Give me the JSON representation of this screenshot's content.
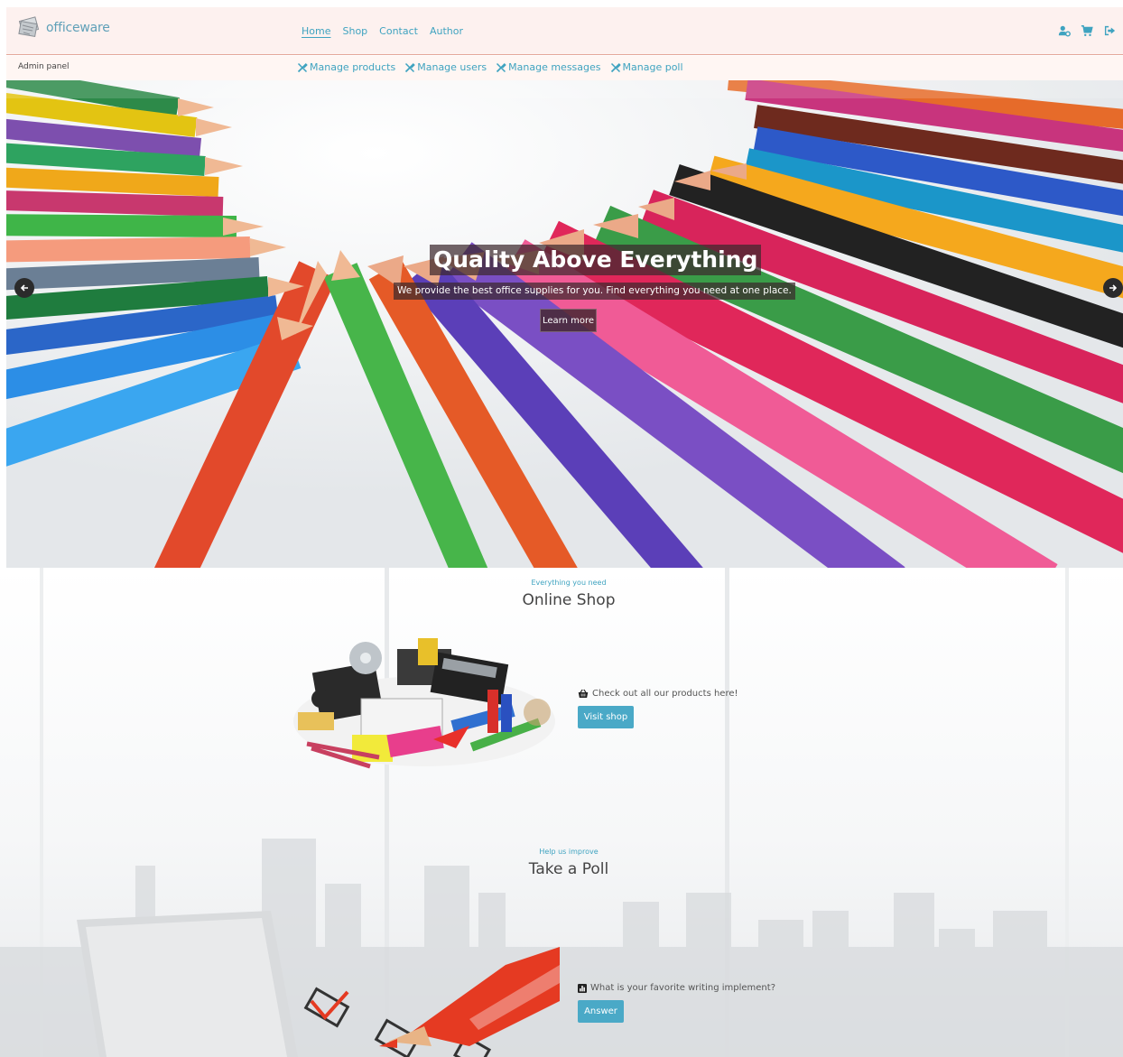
{
  "brand": {
    "name": "officeware",
    "icon": "logo-icon"
  },
  "nav": {
    "links": [
      {
        "label": "Home",
        "active": true
      },
      {
        "label": "Shop"
      },
      {
        "label": "Contact"
      },
      {
        "label": "Author"
      }
    ],
    "icons": [
      "user-cog-icon",
      "cart-icon",
      "sign-out-icon"
    ]
  },
  "admin": {
    "label": "Admin panel",
    "links": [
      {
        "label": "Manage products",
        "icon": "tools-icon"
      },
      {
        "label": "Manage users",
        "icon": "tools-icon"
      },
      {
        "label": "Manage messages",
        "icon": "tools-icon"
      },
      {
        "label": "Manage poll",
        "icon": "tools-icon"
      }
    ]
  },
  "hero": {
    "title": "Quality Above Everything",
    "subtitle": "We provide the best office supplies for you. Find everything you need at one place.",
    "button": "Learn more",
    "prev_icon": "arrow-left-icon",
    "next_icon": "arrow-right-icon"
  },
  "shop_section": {
    "eyebrow": "Everything you need",
    "title": "Online Shop",
    "text": "Check out all our products here!",
    "icon": "shopping-basket-icon",
    "button": "Visit shop"
  },
  "poll_section": {
    "eyebrow": "Help us improve",
    "title": "Take a Poll",
    "text": "What is your favorite writing implement?",
    "icon": "poll-icon",
    "button": "Answer"
  },
  "colors": {
    "accent": "#3fa3c0",
    "button": "#4aa9c7",
    "navbar_bg": "#fdf1ef",
    "navbar_border": "#e4a79a"
  }
}
